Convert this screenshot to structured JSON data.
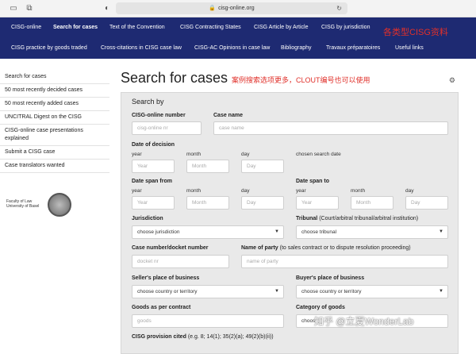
{
  "browser": {
    "url": "cisg-online.org",
    "sidebar_toggle_icon": "sidebar-toggle-icon",
    "tab_icon": "tab-icon",
    "shield_icon": "privacy-shield-icon"
  },
  "nav": {
    "row1": [
      "CISG-online",
      "Search for cases",
      "Text of the Convention",
      "CISG Contracting States",
      "CISG Article by Article",
      "CISG by jurisdiction"
    ],
    "row2": [
      "CISG practice by goods traded",
      "Cross-citations in CISG case law",
      "CISG-AC Opinions in case law",
      "Bibliography",
      "Travaux préparatoires",
      "Useful links"
    ],
    "annotation": "各类型CISG资料"
  },
  "sidebar": {
    "items": [
      "Search for cases",
      "50 most recently decided cases",
      "50 most recently added cases",
      "UNCITRAL Digest on the CISG",
      "CISG-online case presentations explained",
      "Submit a CISG case",
      "Case translators wanted"
    ],
    "logo_line1": "Faculty of Law",
    "logo_line2": "University of Basel"
  },
  "main": {
    "title": "Search for cases",
    "annotation": "案例搜索选项更多，CLOUT编号也可以使用",
    "panel_heading": "Search by",
    "cisg_number": {
      "label": "CISG-online number",
      "placeholder": "cisg-online nr"
    },
    "case_name": {
      "label": "Case name",
      "placeholder": "case name"
    },
    "date_decision": {
      "label": "Date of decision",
      "year": "year",
      "month": "month",
      "day": "day",
      "year_ph": "Year",
      "month_ph": "Month",
      "day_ph": "Day",
      "chosen": "chosen search date"
    },
    "date_span_from": {
      "label": "Date span from",
      "year": "year",
      "month": "month",
      "day": "day",
      "year_ph": "Year",
      "month_ph": "Month",
      "day_ph": "Day"
    },
    "date_span_to": {
      "label": "Date span to",
      "year": "year",
      "month": "month",
      "day": "day",
      "year_ph": "Year",
      "month_ph": "Month",
      "day_ph": "Day"
    },
    "jurisdiction": {
      "label": "Jurisdiction",
      "value": "choose jurisdiction"
    },
    "tribunal": {
      "label": "Tribunal",
      "hint": "(Court/arbitral tribunal/arbitral institution)",
      "value": "choose tribunal"
    },
    "case_number": {
      "label": "Case number/docket number",
      "placeholder": "docket nr"
    },
    "party": {
      "label": "Name of party",
      "hint": "(to sales contract or to dispute resolution proceeding)",
      "placeholder": "name of party"
    },
    "seller": {
      "label": "Seller's place of business",
      "value": "choose country or territory"
    },
    "buyer": {
      "label": "Buyer's place of business",
      "value": "choose country or territory"
    },
    "goods": {
      "label": "Goods as per contract",
      "placeholder": "goods"
    },
    "category": {
      "label": "Category of goods",
      "value": "choos"
    },
    "provision": {
      "label": "CISG provision cited",
      "hint": "(e.g. 8; 14(1); 35(2)(a); 49(2)(b)(ii))"
    }
  },
  "watermark": "知乎 @立夏WonderLab",
  "colors": {
    "nav_bg": "#1e2a72",
    "annotation_red": "#e0302a",
    "panel_bg": "#e9e9e9"
  }
}
